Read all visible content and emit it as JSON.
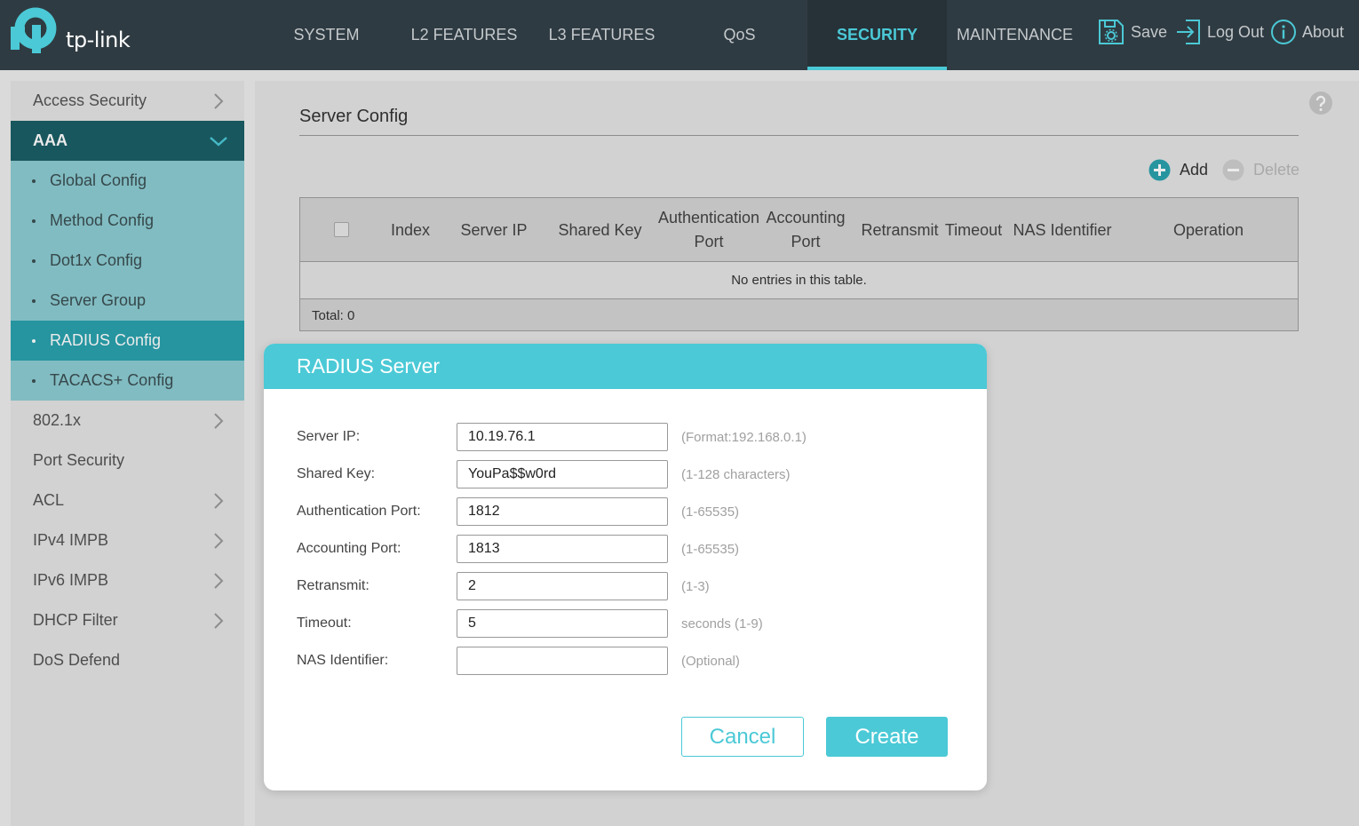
{
  "brand": {
    "name": "tp-link",
    "accent": "#4bc9d6"
  },
  "nav": {
    "tabs": [
      {
        "label": "SYSTEM",
        "active": false
      },
      {
        "label": "L2 FEATURES",
        "active": false
      },
      {
        "label": "L3 FEATURES",
        "active": false
      },
      {
        "label": "QoS",
        "active": false
      },
      {
        "label": "SECURITY",
        "active": true
      },
      {
        "label": "MAINTENANCE",
        "active": false
      }
    ],
    "tools": {
      "save": "Save",
      "logout": "Log Out",
      "about": "About"
    }
  },
  "sidebar": {
    "items": [
      {
        "label": "Access Security",
        "chevron": true
      },
      {
        "label": "AAA",
        "expanded": true
      },
      {
        "label": "Global Config"
      },
      {
        "label": "Method Config"
      },
      {
        "label": "Dot1x Config"
      },
      {
        "label": "Server Group"
      },
      {
        "label": "RADIUS Config",
        "selected": true
      },
      {
        "label": "TACACS+ Config"
      },
      {
        "label": "802.1x",
        "chevron": true
      },
      {
        "label": "Port Security",
        "chevron": false
      },
      {
        "label": "ACL",
        "chevron": true
      },
      {
        "label": "IPv4 IMPB",
        "chevron": true
      },
      {
        "label": "IPv6 IMPB",
        "chevron": true
      },
      {
        "label": "DHCP Filter",
        "chevron": true
      },
      {
        "label": "DoS Defend",
        "chevron": false
      }
    ]
  },
  "main": {
    "section_title": "Server Config",
    "actions": {
      "add": "Add",
      "delete": "Delete"
    },
    "table": {
      "columns": [
        "Index",
        "Server IP",
        "Shared Key",
        "Authentication Port",
        "Accounting Port",
        "Retransmit",
        "Timeout",
        "NAS Identifier",
        "Operation"
      ],
      "empty_text": "No entries in this table.",
      "total": "Total: 0"
    }
  },
  "modal": {
    "title": "RADIUS Server",
    "fields": [
      {
        "label": "Server IP:",
        "value": "10.19.76.1",
        "hint": "(Format:192.168.0.1)"
      },
      {
        "label": "Shared Key:",
        "value": "YouPa$$w0rd",
        "hint": "(1-128 characters)"
      },
      {
        "label": "Authentication Port:",
        "value": "1812",
        "hint": "(1-65535)"
      },
      {
        "label": "Accounting Port:",
        "value": "1813",
        "hint": "(1-65535)"
      },
      {
        "label": "Retransmit:",
        "value": "2",
        "hint": "(1-3)"
      },
      {
        "label": "Timeout:",
        "value": "5",
        "hint": "seconds (1-9)"
      },
      {
        "label": "NAS Identifier:",
        "value": "",
        "hint": "(Optional)"
      }
    ],
    "cancel": "Cancel",
    "create": "Create"
  }
}
